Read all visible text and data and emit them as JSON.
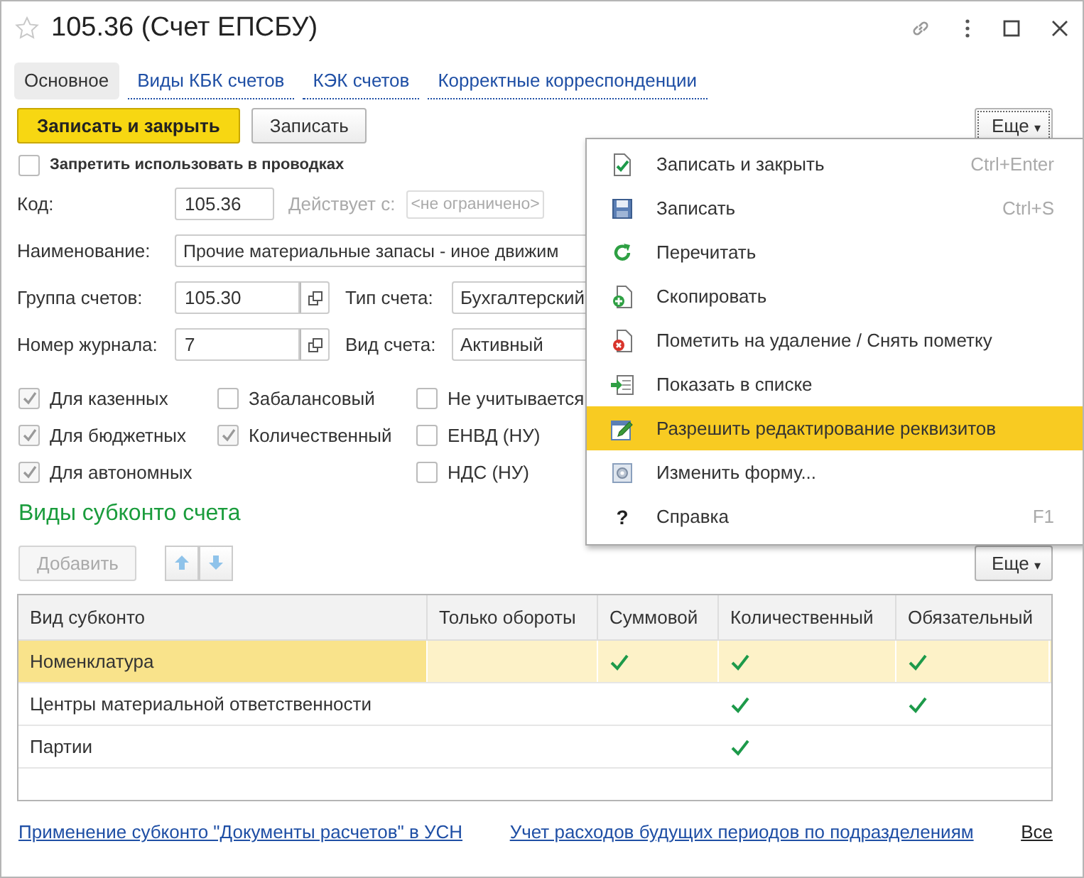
{
  "window": {
    "title": "105.36 (Счет ЕПСБУ)",
    "favorite": false
  },
  "tabs": [
    {
      "label": "Основное",
      "selected": true
    },
    {
      "label": "Виды КБК счетов",
      "selected": false
    },
    {
      "label": "КЭК счетов",
      "selected": false
    },
    {
      "label": "Корректные корреспонденции",
      "selected": false
    }
  ],
  "toolbar": {
    "primary": "Записать и закрыть",
    "secondary": "Записать",
    "more": "Еще",
    "caret": "▾"
  },
  "prohibit": {
    "label": "Запретить использовать в проводках",
    "checked": false
  },
  "fields": {
    "code": {
      "label": "Код:",
      "value": "105.36"
    },
    "valid_from": {
      "label": "Действует с:",
      "placeholder": "<не ограничено>"
    },
    "name": {
      "label": "Наименование:",
      "value": "Прочие материальные запасы - иное движим"
    },
    "group": {
      "label": "Группа счетов:",
      "value": "105.30"
    },
    "type": {
      "label": "Тип счета:",
      "value": "Бухгалтерский"
    },
    "journal": {
      "label": "Номер журнала:",
      "value": "7"
    },
    "kind": {
      "label": "Вид счета:",
      "value": "Активный"
    }
  },
  "flags": [
    [
      {
        "label": "Для казенных",
        "checked": true
      },
      {
        "label": "Для бюджетных",
        "checked": true
      },
      {
        "label": "Для автономных",
        "checked": true
      }
    ],
    [
      {
        "label": "Забалансовый",
        "checked": false
      },
      {
        "label": "Количественный",
        "checked": true
      }
    ],
    [
      {
        "label": "Не учитывается",
        "checked": false
      },
      {
        "label": "ЕНВД (НУ)",
        "checked": false
      },
      {
        "label": "НДС (НУ)",
        "checked": false
      }
    ]
  ],
  "subconto": {
    "title": "Виды субконто счета",
    "add": "Добавить",
    "more": "Еще",
    "caret": "▾",
    "columns": [
      "Вид субконто",
      "Только обороты",
      "Суммовой",
      "Количественный",
      "Обязательный"
    ],
    "rows": [
      {
        "name": "Номенклатура",
        "selected": true,
        "turnover_only": false,
        "sum": true,
        "quantity": true,
        "required": true
      },
      {
        "name": "Центры материальной ответственности",
        "selected": false,
        "turnover_only": false,
        "sum": false,
        "quantity": true,
        "required": true
      },
      {
        "name": "Партии",
        "selected": false,
        "turnover_only": false,
        "sum": false,
        "quantity": true,
        "required": false
      }
    ]
  },
  "links": [
    "Применение субконто \"Документы расчетов\" в УСН",
    "Учет расходов будущих периодов по подразделениям",
    "Все"
  ],
  "menu": [
    {
      "kind": "save-close",
      "label": "Записать и закрыть",
      "shortcut": "Ctrl+Enter",
      "selected": false
    },
    {
      "kind": "save",
      "label": "Записать",
      "shortcut": "Ctrl+S",
      "selected": false
    },
    {
      "kind": "reread",
      "label": "Перечитать",
      "selected": false
    },
    {
      "kind": "copy",
      "label": "Скопировать",
      "selected": false
    },
    {
      "kind": "delete-mark",
      "label": "Пометить на удаление / Снять пометку",
      "selected": false
    },
    {
      "kind": "show-list",
      "label": "Показать в списке",
      "selected": false
    },
    {
      "kind": "edit",
      "label": "Разрешить редактирование реквизитов",
      "selected": true
    },
    {
      "kind": "form",
      "label": "Изменить форму...",
      "selected": false
    },
    {
      "kind": "help",
      "glyph": "?",
      "label": "Справка",
      "shortcut": "F1",
      "selected": false
    }
  ]
}
